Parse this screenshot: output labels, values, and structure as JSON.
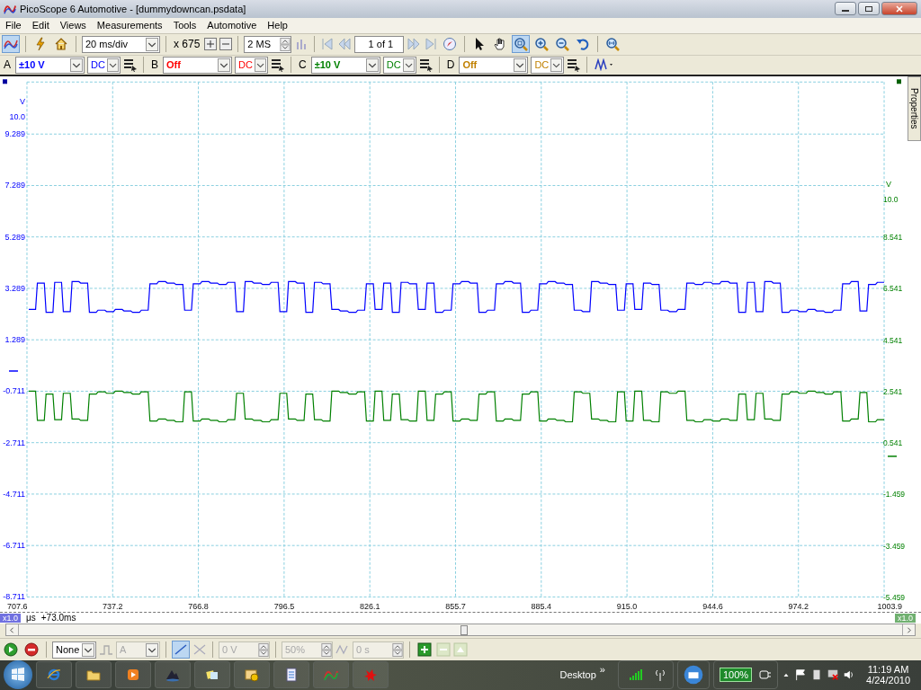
{
  "window": {
    "title": "PicoScope 6 Automotive - [dummydowncan.psdata]"
  },
  "menu": [
    "File",
    "Edit",
    "Views",
    "Measurements",
    "Tools",
    "Automotive",
    "Help"
  ],
  "modes": [
    {
      "kind": "scope",
      "selected": true
    }
  ],
  "toolbar": {
    "timebase": "20 ms/div",
    "zoom": "x 675",
    "samples": "2 MS",
    "buffer": "1 of 1"
  },
  "tools": [
    {
      "kind": "pointer",
      "selected": false
    },
    {
      "kind": "hand",
      "selected": false
    },
    {
      "kind": "zoom-area",
      "selected": true
    },
    {
      "kind": "zoom-in",
      "selected": false
    },
    {
      "kind": "zoom-out",
      "selected": false
    },
    {
      "kind": "undo",
      "selected": false
    }
  ],
  "channels": [
    {
      "letter": "A",
      "range": "±10 V",
      "coupling": "DC",
      "color": "#0000ff"
    },
    {
      "letter": "B",
      "range": "Off",
      "coupling": "DC",
      "color": "#ff0000"
    },
    {
      "letter": "C",
      "range": "±10 V",
      "coupling": "DC",
      "color": "#008000"
    },
    {
      "letter": "D",
      "range": "Off",
      "coupling": "DC",
      "color": "#c08000"
    }
  ],
  "plot": {
    "left_axis": {
      "unit": "V",
      "labels": [
        "10.0",
        "9.289",
        "7.289",
        "5.289",
        "3.289",
        "1.289",
        "-0.711",
        "-2.711",
        "-4.711",
        "-6.711",
        "-8.711"
      ]
    },
    "right_axis": {
      "unit": "V",
      "labels": [
        "10.0",
        "8.541",
        "6.541",
        "4.541",
        "2.541",
        "0.541",
        "-1.459",
        "-3.459",
        "-5.459"
      ]
    },
    "x_labels": [
      "707.6",
      "737.2",
      "766.8",
      "796.5",
      "826.1",
      "855.7",
      "885.4",
      "915.0",
      "944.6",
      "974.2",
      "1003.9"
    ],
    "x_unit": "μs",
    "x_offset": "+73.0ms",
    "left_scale": "x1.0",
    "right_scale": "x1.0",
    "properties_tab": "Properties"
  },
  "trigger": [
    {
      "kind": "combo",
      "value": "None",
      "disabled": false
    },
    {
      "kind": "combo",
      "value": "A",
      "disabled": true
    },
    {
      "kind": "spin",
      "value": "0 V",
      "disabled": true
    },
    {
      "kind": "spin",
      "value": "50%",
      "disabled": true
    },
    {
      "kind": "spin",
      "value": "0 s",
      "disabled": true
    }
  ],
  "taskbar": {
    "desktop": "Desktop",
    "more": "»",
    "battery": "100%",
    "time": "11:19 AM",
    "date": "4/24/2010"
  }
}
